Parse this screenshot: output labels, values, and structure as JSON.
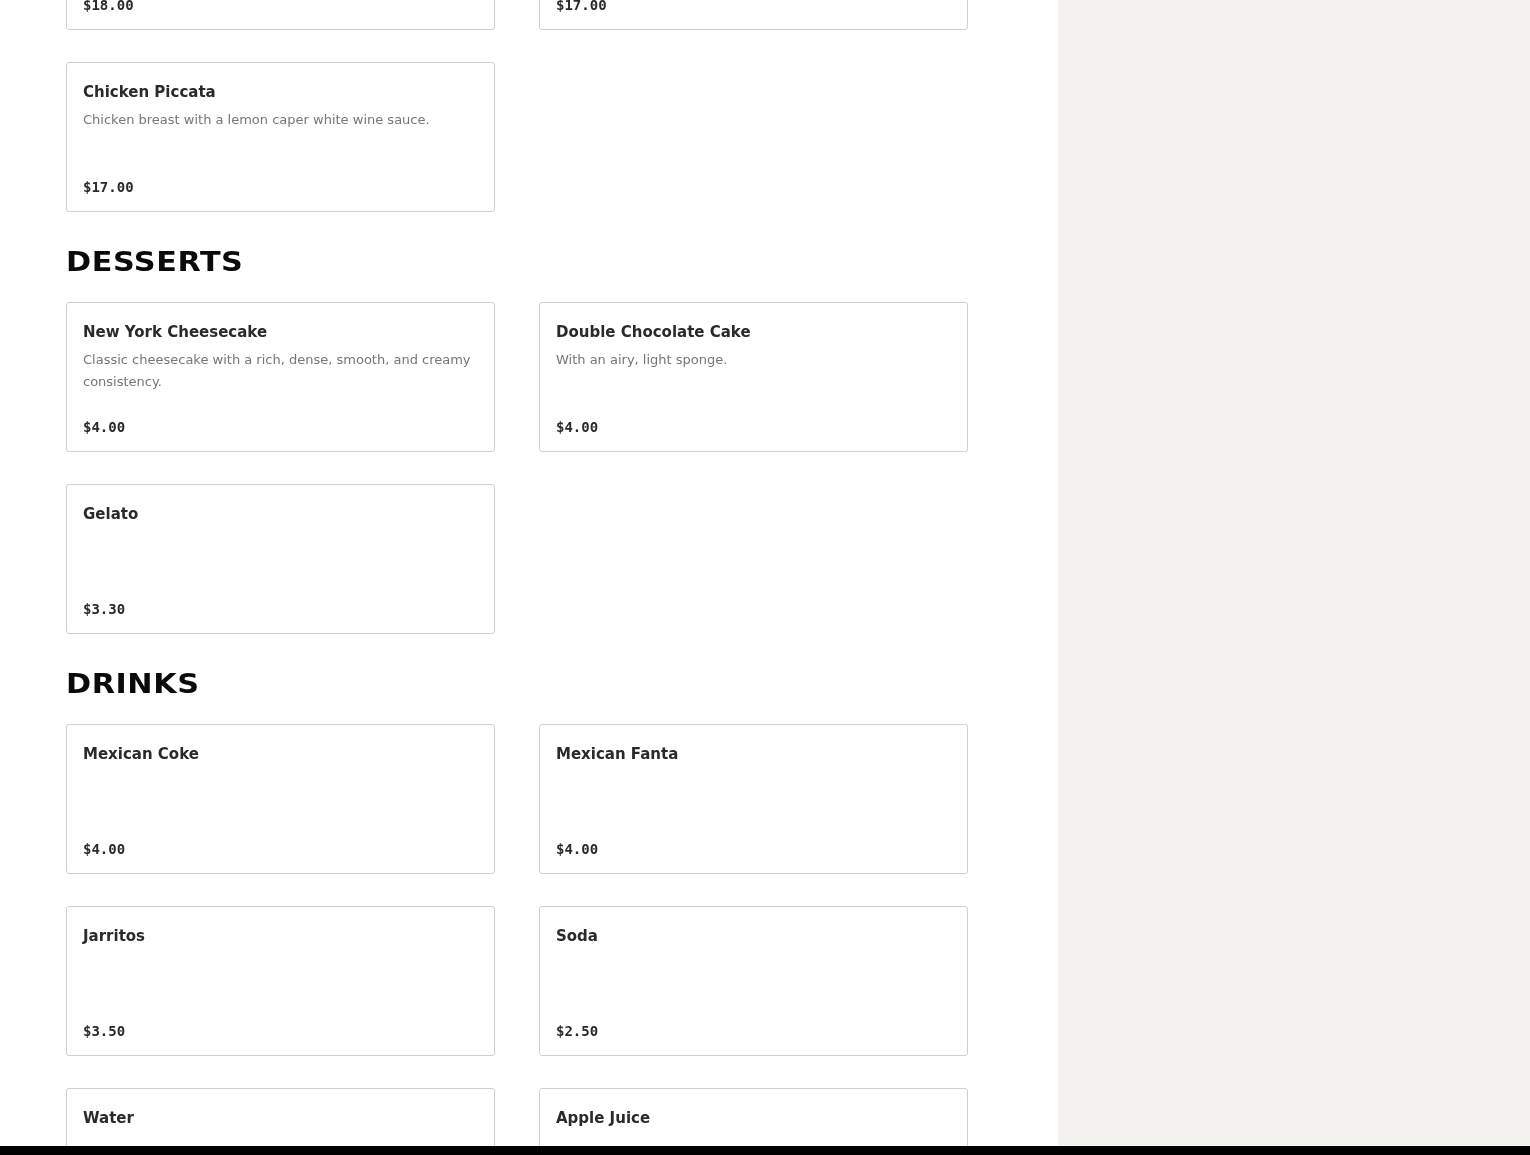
{
  "sections": [
    {
      "items": [
        {
          "price": "$18.00"
        },
        {
          "price": "$17.00"
        },
        {
          "name": "Chicken Piccata",
          "description": "Chicken breast with a lemon caper white wine sauce.",
          "price": "$17.00"
        }
      ]
    },
    {
      "heading": "DESSERTS",
      "items": [
        {
          "name": "New York Cheesecake",
          "description": "Classic cheesecake with a rich, dense, smooth, and creamy consistency.",
          "price": "$4.00"
        },
        {
          "name": "Double Chocolate Cake",
          "description": "With an airy, light sponge.",
          "price": "$4.00"
        },
        {
          "name": "Gelato",
          "price": "$3.30"
        }
      ]
    },
    {
      "heading": "DRINKS",
      "items": [
        {
          "name": "Mexican Coke",
          "price": "$4.00"
        },
        {
          "name": "Mexican Fanta",
          "price": "$4.00"
        },
        {
          "name": "Jarritos",
          "price": "$3.50"
        },
        {
          "name": "Soda",
          "price": "$2.50"
        },
        {
          "name": "Water"
        },
        {
          "name": "Apple Juice"
        }
      ]
    }
  ]
}
